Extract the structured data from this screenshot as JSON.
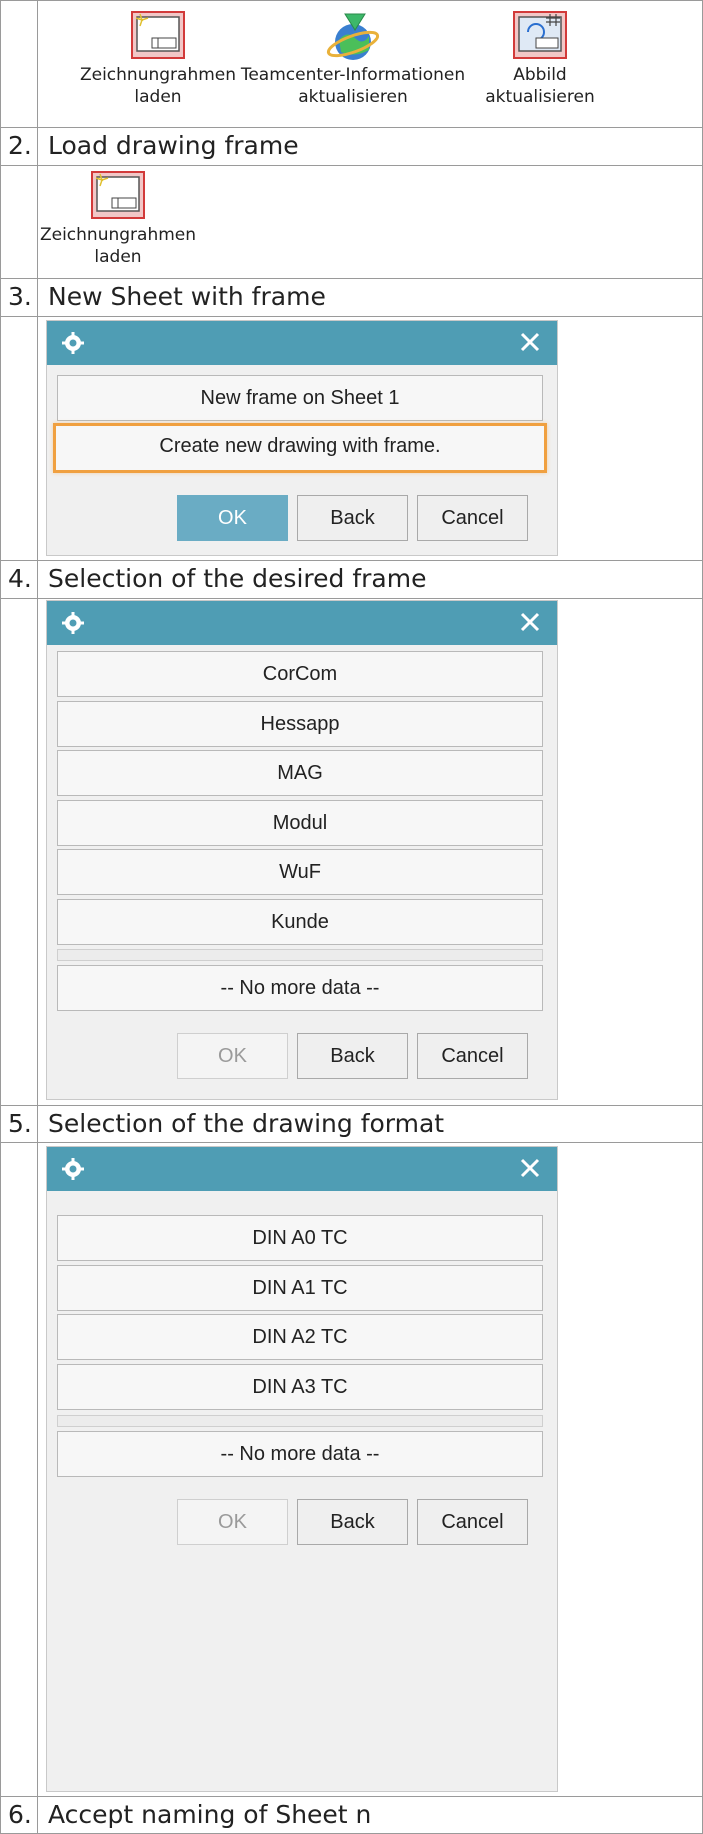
{
  "ribbon": {
    "buttons": [
      {
        "line1": "Zeichnungrahmen",
        "line2": "laden",
        "icon": "drawing-frame-icon"
      },
      {
        "line1": "Teamcenter-Informationen",
        "line2": "aktualisieren",
        "icon": "teamcenter-globe-icon"
      },
      {
        "line1": "Abbild",
        "line2": "aktualisieren",
        "icon": "update-image-icon"
      }
    ]
  },
  "steps": [
    {
      "num": "2.",
      "text": "Load drawing frame"
    },
    {
      "num": "3.",
      "text": "New Sheet with frame"
    },
    {
      "num": "4.",
      "text": "Selection of the desired frame"
    },
    {
      "num": "5.",
      "text": "Selection of the drawing format"
    },
    {
      "num": "6.",
      "text": "Accept naming of Sheet n"
    }
  ],
  "step2_button": {
    "line1": "Zeichnungrahmen",
    "line2": "laden"
  },
  "dialog_sheet": {
    "options": [
      "New frame on Sheet 1",
      "Create new drawing with frame."
    ],
    "ok": "OK",
    "back": "Back",
    "cancel": "Cancel"
  },
  "dialog_frame": {
    "options": [
      "CorCom",
      "Hessapp",
      "MAG",
      "Modul",
      "WuF",
      "Kunde"
    ],
    "no_more": "-- No more data --",
    "ok": "OK",
    "back": "Back",
    "cancel": "Cancel"
  },
  "dialog_format": {
    "options": [
      "DIN A0 TC",
      "DIN A1 TC",
      "DIN A2 TC",
      "DIN A3 TC"
    ],
    "no_more": "-- No more data --",
    "ok": "OK",
    "back": "Back",
    "cancel": "Cancel"
  },
  "colors": {
    "title_bar": "#4f9db4",
    "ok_active": "#6aacc4",
    "highlight": "#f0a040"
  }
}
